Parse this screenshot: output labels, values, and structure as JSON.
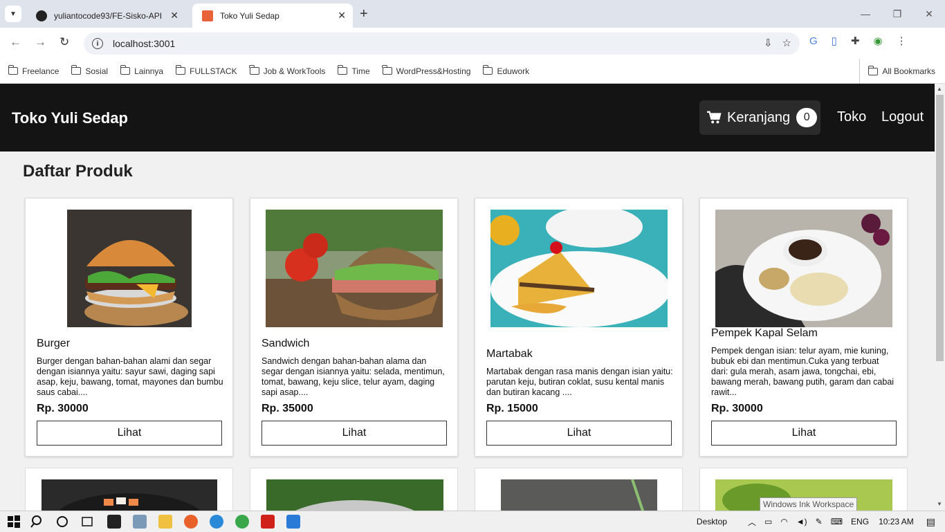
{
  "browser": {
    "tabs": [
      {
        "title": "yuliantocode93/FE-Sisko-API",
        "active": false
      },
      {
        "title": "Toko Yuli Sedap",
        "active": true
      }
    ],
    "address": "localhost:3001",
    "bookmarks": [
      "Freelance",
      "Sosial",
      "Lainnya",
      "FULLSTACK",
      "Job & WorkTools",
      "Time",
      "WordPress&Hosting",
      "Eduwork"
    ],
    "all_bookmarks": "All Bookmarks"
  },
  "navbar": {
    "brand": "Toko Yuli Sedap",
    "cart_label": "Keranjang",
    "cart_count": "0",
    "link_toko": "Toko",
    "link_logout": "Logout"
  },
  "page": {
    "title": "Daftar Produk"
  },
  "products": [
    {
      "name": "Burger",
      "desc": "Burger dengan bahan-bahan alami dan segar dengan isiannya yaitu: sayur sawi, daging sapi asap, keju, bawang, tomat, mayones dan bumbu saus cabai....",
      "price": "Rp. 30000",
      "button": "Lihat"
    },
    {
      "name": "Sandwich",
      "desc": "Sandwich dengan bahan-bahan alama dan segar dengan isiannya yaitu: selada, mentimun, tomat, bawang, keju slice, telur ayam, daging sapi asap....",
      "price": "Rp. 35000",
      "button": "Lihat"
    },
    {
      "name": "Martabak",
      "desc": "Martabak dengan rasa manis dengan isian yaitu: parutan keju, butiran coklat, susu kental manis dan butiran kacang ....",
      "price": "Rp. 15000",
      "button": "Lihat"
    },
    {
      "name": "Pempek Kapal Selam",
      "desc": "Pempek dengan isian: telur ayam, mie kuning, bubuk ebi dan mentimun.Cuka yang terbuat dari: gula merah, asam jawa, tongchai, ebi, bawang merah, bawang putih, garam dan cabai rawit...",
      "price": "Rp. 30000",
      "button": "Lihat"
    }
  ],
  "taskbar": {
    "desktop": "Desktop",
    "lang": "ENG",
    "time": "10:23 AM",
    "tooltip": "Windows Ink Workspace"
  }
}
